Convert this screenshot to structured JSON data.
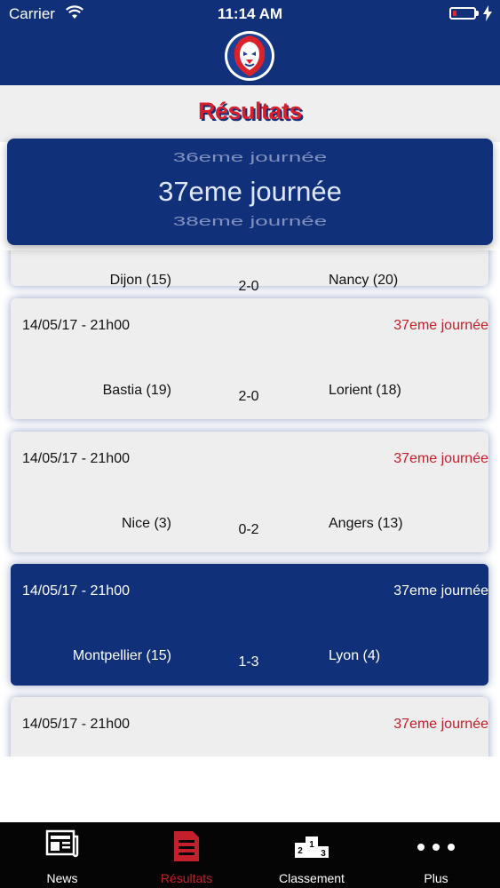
{
  "status_bar": {
    "carrier": "Carrier",
    "time": "11:14 AM",
    "battery_level": 0.2
  },
  "header": {
    "title": "Résultats"
  },
  "round_picker": {
    "previous": "36eme journée",
    "current": "37eme journée",
    "next": "38eme journée"
  },
  "matches": [
    {
      "date": "",
      "round": "",
      "home": "Dijon (15)",
      "score": "2-0",
      "away": "Nancy (20)",
      "highlighted": false
    },
    {
      "date": "14/05/17 - 21h00",
      "round": "37eme journée",
      "home": "Bastia (19)",
      "score": "2-0",
      "away": "Lorient (18)",
      "highlighted": false
    },
    {
      "date": "14/05/17 - 21h00",
      "round": "37eme journée",
      "home": "Nice (3)",
      "score": "0-2",
      "away": "Angers (13)",
      "highlighted": false
    },
    {
      "date": "14/05/17 - 21h00",
      "round": "37eme journée",
      "home": "Montpellier (15)",
      "score": "1-3",
      "away": "Lyon (4)",
      "highlighted": true
    },
    {
      "date": "14/05/17 - 21h00",
      "round": "37eme journée",
      "home": "",
      "score": "",
      "away": "",
      "highlighted": false
    }
  ],
  "tabs": [
    {
      "label": "News",
      "icon": "newspaper-icon"
    },
    {
      "label": "Résultats",
      "icon": "document-icon"
    },
    {
      "label": "Classement",
      "icon": "podium-icon"
    },
    {
      "label": "Plus",
      "icon": "more-dots-icon"
    }
  ],
  "colors": {
    "navy": "#10307a",
    "red": "#c4202b",
    "title_red": "#d7202e",
    "card_bg": "#eeeeee"
  }
}
